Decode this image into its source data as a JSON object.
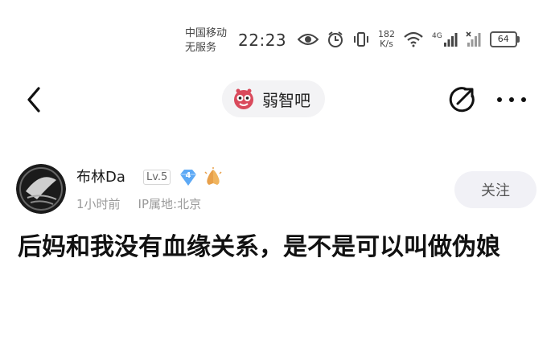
{
  "status_bar": {
    "carrier_line1": "中国移动",
    "carrier_line2": "无服务",
    "time": "22:23",
    "net_speed_value": "182",
    "net_speed_unit": "K/s",
    "signal_label": "4G",
    "battery": "64"
  },
  "nav": {
    "forum_name": "弱智吧"
  },
  "author": {
    "name": "布林Da",
    "level": "Lv.5",
    "gem_level": "4",
    "time_ago": "1小时前",
    "ip_location": "IP属地:北京"
  },
  "follow_label": "关注",
  "post": {
    "text": "后妈和我没有血缘关系，是不是可以叫做伪娘"
  },
  "colors": {
    "accent_badge": "#5da9f5",
    "forum_logo": "#d94a5c",
    "hands_badge": "#e8a04a"
  }
}
